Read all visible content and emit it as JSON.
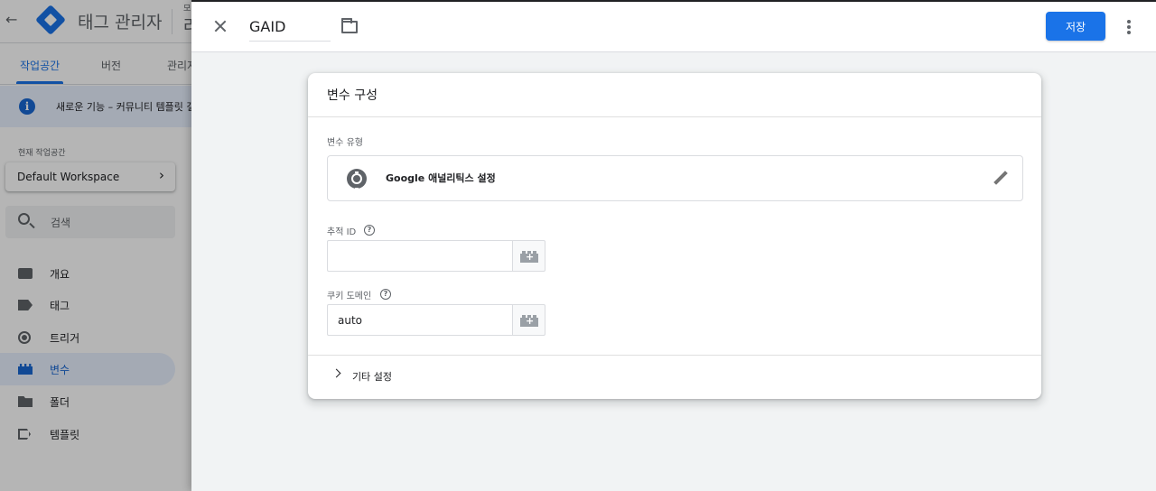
{
  "app": {
    "title": "태그 관리자",
    "account_small": "모",
    "account_name": "라",
    "tabs": [
      {
        "label": "작업공간",
        "active": true
      },
      {
        "label": "버전",
        "active": false
      },
      {
        "label": "관리자",
        "active": false
      }
    ],
    "banner_text": "새로운 기능 – 커뮤니티 템플릿 갤",
    "workspace_label": "현재 작업공간",
    "workspace_name": "Default Workspace",
    "search_placeholder": "검색",
    "nav": [
      {
        "label": "개요",
        "icon": "overview-icon",
        "active": false
      },
      {
        "label": "태그",
        "icon": "tag-icon",
        "active": false
      },
      {
        "label": "트리거",
        "icon": "trigger-icon",
        "active": false
      },
      {
        "label": "변수",
        "icon": "variable-icon",
        "active": true
      },
      {
        "label": "폴더",
        "icon": "folder-icon",
        "active": false
      },
      {
        "label": "템플릿",
        "icon": "template-icon",
        "active": false
      }
    ]
  },
  "panel": {
    "name_value": "GAID",
    "save_label": "저장",
    "card_title": "변수 구성",
    "variable_type_label": "변수 유형",
    "variable_type_name": "Google 애널리틱스 설정",
    "tracking_id_label": "추적 ID",
    "tracking_id_value": "",
    "cookie_domain_label": "쿠키 도메인",
    "cookie_domain_value": "auto",
    "more_settings_label": "기타 설정"
  },
  "colors": {
    "accent": "#1a73e8",
    "active_nav_bg": "#e8f0fe",
    "panel_bg": "#f1f3f4"
  }
}
